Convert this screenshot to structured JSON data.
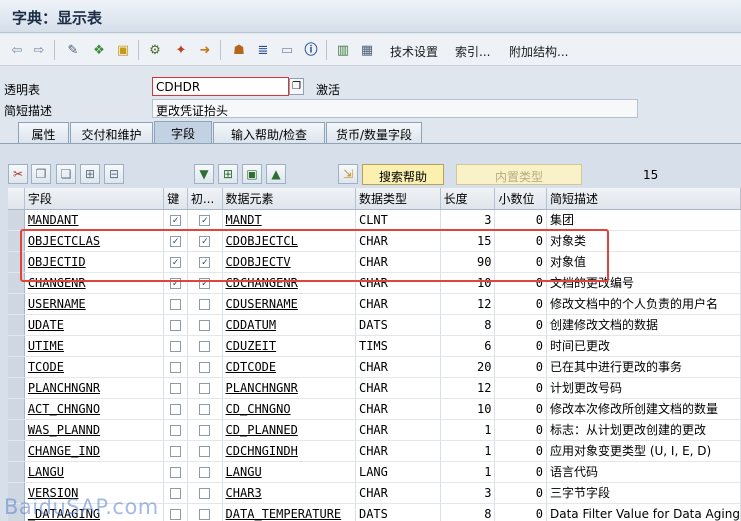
{
  "window": {
    "title": "字典：显示表"
  },
  "toolbar": {
    "icons": [
      "back-arrow-icon",
      "forward-arrow-icon",
      "edit-display-icon",
      "other-object-icon",
      "activate-icon",
      "check-icon",
      "where-used-icon",
      "navigate-icon",
      "hierarchy-icon",
      "display-object-list-icon",
      "insert-icon",
      "info-icon",
      "index-icon",
      "contents-icon"
    ],
    "technical_settings": "技术设置",
    "index": "索引...",
    "append_structure": "附加结构..."
  },
  "header": {
    "transparent_table_label": "透明表",
    "table_name": "CDHDR",
    "status": "激活",
    "short_desc_label": "简短描述",
    "short_desc": "更改凭证抬头"
  },
  "tabs": [
    {
      "label": "属性",
      "active": false
    },
    {
      "label": "交付和维护",
      "active": false
    },
    {
      "label": "字段",
      "active": true
    },
    {
      "label": "输入帮助/检查",
      "active": false
    },
    {
      "label": "货币/数量字段",
      "active": false
    }
  ],
  "field_toolbar": {
    "search_help": "搜索帮助",
    "builtin_type": "内置类型",
    "count": "15"
  },
  "grid": {
    "columns": [
      "字段",
      "键",
      "初...",
      "数据元素",
      "数据类型",
      "长度",
      "小数位",
      "简短描述"
    ],
    "rows": [
      {
        "field": "MANDANT",
        "key": true,
        "init": true,
        "data_element": "MANDT",
        "type": "CLNT",
        "length": "3",
        "decimals": "0",
        "desc": "集团"
      },
      {
        "field": "OBJECTCLAS",
        "key": true,
        "init": true,
        "data_element": "CDOBJECTCL",
        "type": "CHAR",
        "length": "15",
        "decimals": "0",
        "desc": "对象类"
      },
      {
        "field": "OBJECTID",
        "key": true,
        "init": true,
        "data_element": "CDOBJECTV",
        "type": "CHAR",
        "length": "90",
        "decimals": "0",
        "desc": "对象值"
      },
      {
        "field": "CHANGENR",
        "key": true,
        "init": true,
        "data_element": "CDCHANGENR",
        "type": "CHAR",
        "length": "10",
        "decimals": "0",
        "desc": "文档的更改编号"
      },
      {
        "field": "USERNAME",
        "key": false,
        "init": false,
        "data_element": "CDUSERNAME",
        "type": "CHAR",
        "length": "12",
        "decimals": "0",
        "desc": "修改文档中的个人负责的用户名"
      },
      {
        "field": "UDATE",
        "key": false,
        "init": false,
        "data_element": "CDDATUM",
        "type": "DATS",
        "length": "8",
        "decimals": "0",
        "desc": "创建修改文档的数据"
      },
      {
        "field": "UTIME",
        "key": false,
        "init": false,
        "data_element": "CDUZEIT",
        "type": "TIMS",
        "length": "6",
        "decimals": "0",
        "desc": "时间已更改"
      },
      {
        "field": "TCODE",
        "key": false,
        "init": false,
        "data_element": "CDTCODE",
        "type": "CHAR",
        "length": "20",
        "decimals": "0",
        "desc": "已在其中进行更改的事务"
      },
      {
        "field": "PLANCHNGNR",
        "key": false,
        "init": false,
        "data_element": "PLANCHNGNR",
        "type": "CHAR",
        "length": "12",
        "decimals": "0",
        "desc": "计划更改号码"
      },
      {
        "field": "ACT_CHNGNO",
        "key": false,
        "init": false,
        "data_element": "CD_CHNGNO",
        "type": "CHAR",
        "length": "10",
        "decimals": "0",
        "desc": "修改本次修改所创建文档的数量"
      },
      {
        "field": "WAS_PLANND",
        "key": false,
        "init": false,
        "data_element": "CD_PLANNED",
        "type": "CHAR",
        "length": "1",
        "decimals": "0",
        "desc": "标志：从计划更改创建的更改"
      },
      {
        "field": "CHANGE_IND",
        "key": false,
        "init": false,
        "data_element": "CDCHNGINDH",
        "type": "CHAR",
        "length": "1",
        "decimals": "0",
        "desc": "应用对象变更类型 (U, I, E, D)"
      },
      {
        "field": "LANGU",
        "key": false,
        "init": false,
        "data_element": "LANGU",
        "type": "LANG",
        "length": "1",
        "decimals": "0",
        "desc": "语言代码"
      },
      {
        "field": "VERSION",
        "key": false,
        "init": false,
        "data_element": "CHAR3",
        "type": "CHAR",
        "length": "3",
        "decimals": "0",
        "desc": "三字节字段"
      },
      {
        "field": "_DATAAGING",
        "key": false,
        "init": false,
        "data_element": "DATA_TEMPERATURE",
        "type": "DATS",
        "length": "8",
        "decimals": "0",
        "desc": "Data Filter Value for Data Aging"
      }
    ]
  },
  "watermark": "BaiduSAP.com",
  "colors": {
    "highlight": "#e2433a",
    "accent": "#fbf0b0"
  }
}
